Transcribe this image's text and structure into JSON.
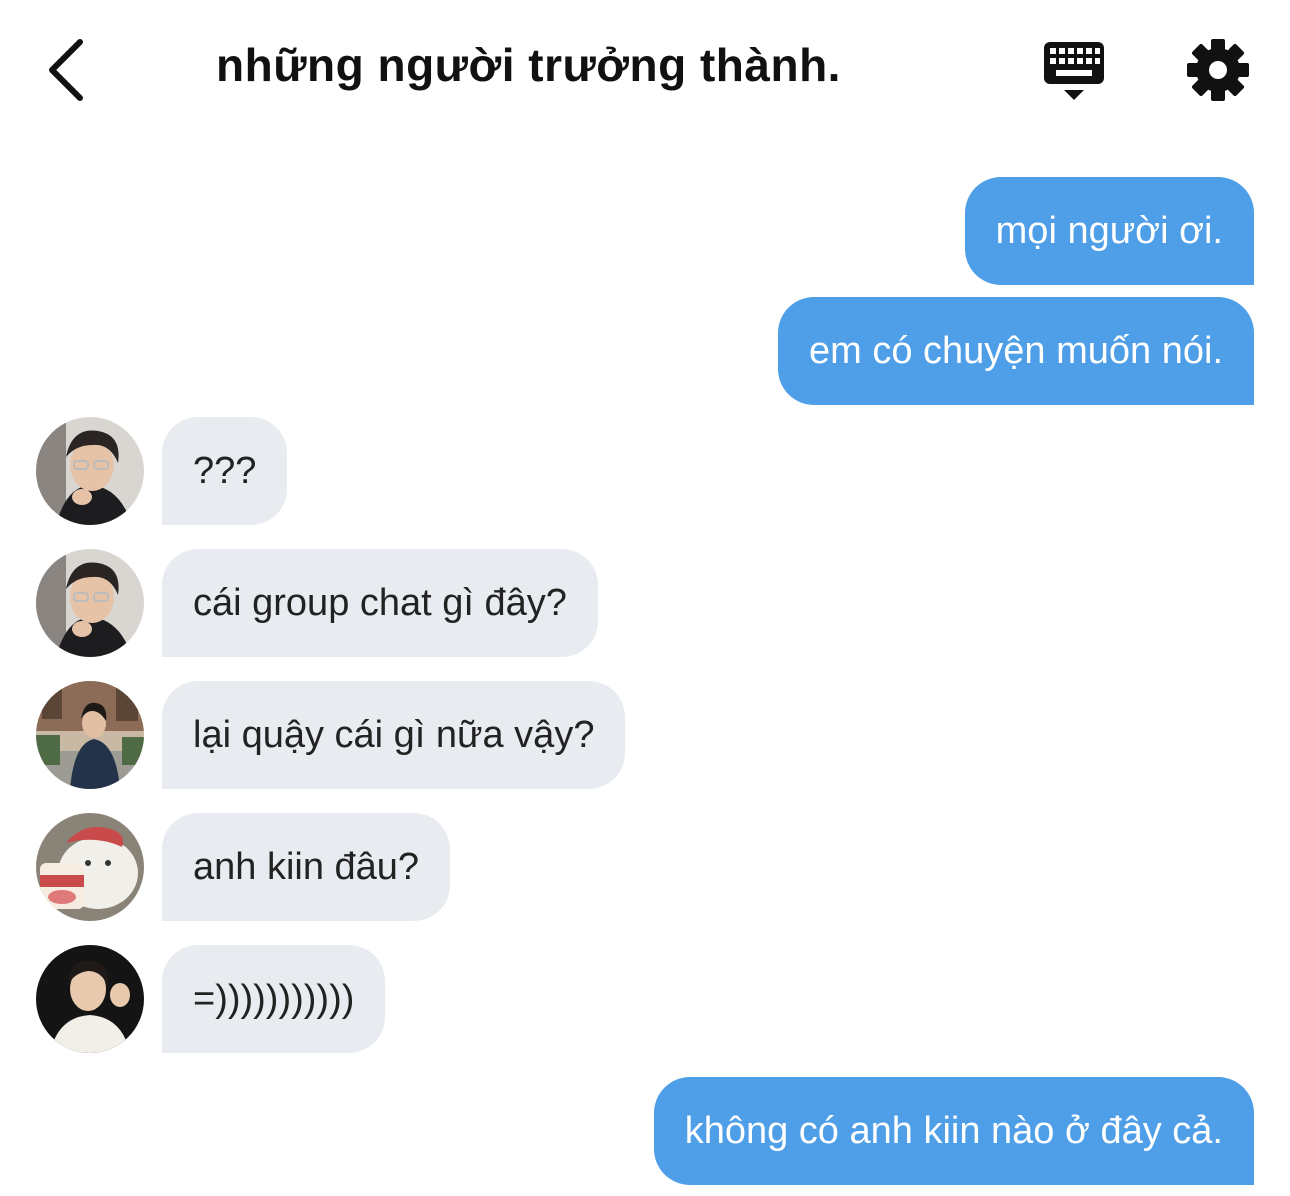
{
  "header": {
    "title": "những người trưởng thành.",
    "back_icon": "chevron-left-icon",
    "keyboard_icon": "keyboard-icon",
    "settings_icon": "gear-icon"
  },
  "colors": {
    "outgoing_bubble": "#4e9ee8",
    "incoming_bubble": "#e8ecf0",
    "text_dark": "#222222"
  },
  "messages": [
    {
      "direction": "out",
      "text": "mọi người ơi."
    },
    {
      "direction": "out",
      "text": "em có chuyện muốn nói."
    },
    {
      "direction": "in",
      "avatar": "avatar-1",
      "text": "???"
    },
    {
      "direction": "in",
      "avatar": "avatar-1",
      "text": "cái group chat gì đây?"
    },
    {
      "direction": "in",
      "avatar": "avatar-2",
      "text": "lại quậy cái gì nữa vậy?"
    },
    {
      "direction": "in",
      "avatar": "avatar-3",
      "text": "anh kiin đâu?"
    },
    {
      "direction": "in",
      "avatar": "avatar-4",
      "text": "=)))))))))))"
    },
    {
      "direction": "out",
      "text": "không có anh kiin nào ở đây cả."
    }
  ]
}
